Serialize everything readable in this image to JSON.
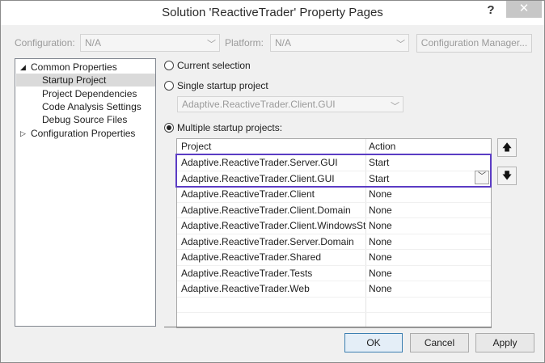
{
  "window": {
    "title": "Solution 'ReactiveTrader' Property Pages",
    "help_glyph": "?",
    "close_glyph": "✕"
  },
  "config": {
    "configuration_label": "Configuration:",
    "configuration_value": "N/A",
    "platform_label": "Platform:",
    "platform_value": "N/A",
    "manager_button": "Configuration Manager..."
  },
  "tree": {
    "common_properties": "Common Properties",
    "startup_project": "Startup Project",
    "project_dependencies": "Project Dependencies",
    "code_analysis_settings": "Code Analysis Settings",
    "debug_source_files": "Debug Source Files",
    "configuration_properties": "Configuration Properties",
    "expanded_glyph": "◢",
    "collapsed_glyph": "▷"
  },
  "startup": {
    "current_selection_label": "Current selection",
    "single_startup_label": "Single startup project",
    "single_startup_value": "Adaptive.ReactiveTrader.Client.GUI",
    "multiple_startup_label": "Multiple startup projects:",
    "selected_option": "multiple"
  },
  "grid": {
    "headers": {
      "project": "Project",
      "action": "Action"
    },
    "rows": [
      {
        "project": "Adaptive.ReactiveTrader.Server.GUI",
        "action": "Start"
      },
      {
        "project": "Adaptive.ReactiveTrader.Client.GUI",
        "action": "Start"
      },
      {
        "project": "Adaptive.ReactiveTrader.Client",
        "action": "None"
      },
      {
        "project": "Adaptive.ReactiveTrader.Client.Domain",
        "action": "None"
      },
      {
        "project": "Adaptive.ReactiveTrader.Client.WindowsSto...",
        "action": "None"
      },
      {
        "project": "Adaptive.ReactiveTrader.Server.Domain",
        "action": "None"
      },
      {
        "project": "Adaptive.ReactiveTrader.Shared",
        "action": "None"
      },
      {
        "project": "Adaptive.ReactiveTrader.Tests",
        "action": "None"
      },
      {
        "project": "Adaptive.ReactiveTrader.Web",
        "action": "None"
      }
    ],
    "move_up_glyph": "🡅",
    "move_down_glyph": "🡇",
    "highlight_color": "#5b3cc4"
  },
  "buttons": {
    "ok": "OK",
    "cancel": "Cancel",
    "apply": "Apply"
  }
}
